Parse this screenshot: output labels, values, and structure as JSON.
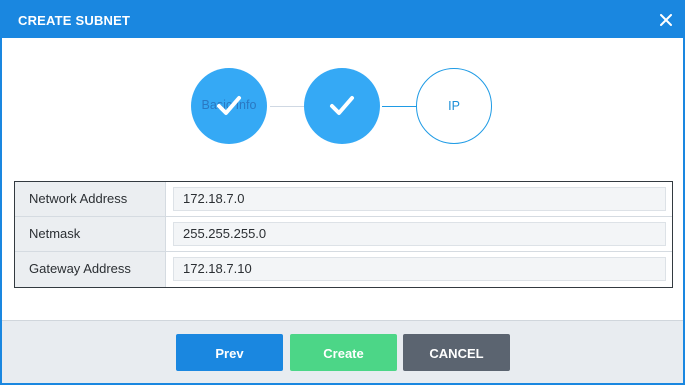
{
  "dialog": {
    "title": "CREATE SUBNET"
  },
  "stepper": {
    "steps": [
      {
        "label": "Basic Info",
        "state": "completed"
      },
      {
        "label": "",
        "state": "completed"
      },
      {
        "label": "IP",
        "state": "active"
      }
    ]
  },
  "form": {
    "rows": [
      {
        "label": "Network Address",
        "value": "172.18.7.0"
      },
      {
        "label": "Netmask",
        "value": "255.255.255.0"
      },
      {
        "label": "Gateway Address",
        "value": "172.18.7.10"
      }
    ]
  },
  "footer": {
    "prev_label": "Prev",
    "create_label": "Create",
    "cancel_label": "CANCEL"
  },
  "colors": {
    "primary": "#1a87e0",
    "step_done": "#35a9f5",
    "create": "#4cd687",
    "cancel": "#5b6470"
  },
  "icons": {
    "close": "close-icon",
    "check": "check-icon"
  }
}
